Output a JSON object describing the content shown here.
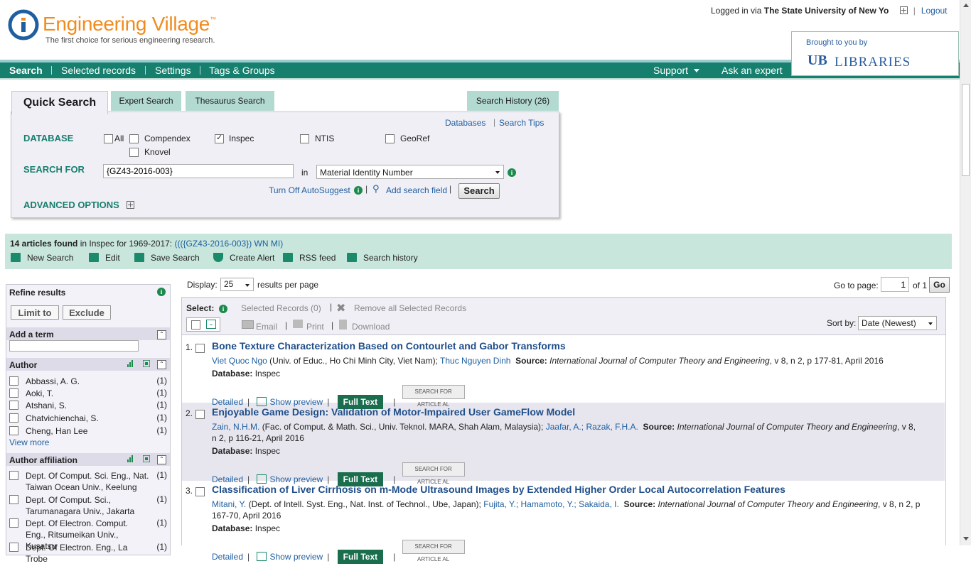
{
  "header": {
    "brand": "Engineering Village",
    "trademark": "™",
    "tagline": "The first choice for serious engineering research.",
    "login_prefix": "Logged in via",
    "login_institution": "The State University of New Yo",
    "logout": "Logout",
    "brought_by": "Brought to you by",
    "library_mark": "UB",
    "library_name": "LIBRARIES"
  },
  "nav": {
    "items": [
      "Search",
      "Selected records",
      "Settings",
      "Tags & Groups"
    ],
    "support": "Support",
    "ask": "Ask an expert"
  },
  "search_tabs": {
    "quick": "Quick Search",
    "expert": "Expert Search",
    "thesaurus": "Thesaurus Search",
    "history": "Search History (26)"
  },
  "search_panel": {
    "databases_link": "Databases",
    "tips_link": "Search Tips",
    "database_label": "DATABASE",
    "databases": [
      {
        "name": "All",
        "checked": false
      },
      {
        "name": "Compendex",
        "checked": false
      },
      {
        "name": "Inspec",
        "checked": true
      },
      {
        "name": "NTIS",
        "checked": false
      },
      {
        "name": "GeoRef",
        "checked": false
      },
      {
        "name": "Knovel",
        "checked": false
      }
    ],
    "search_for_label": "SEARCH FOR",
    "search_value": "{GZ43-2016-003}",
    "in_label": "in",
    "field_value": "Material Identity Number",
    "autosuggest": "Turn Off AutoSuggest",
    "add_field": "Add search field",
    "search_button": "Search",
    "advanced": "ADVANCED OPTIONS"
  },
  "results_bar": {
    "count": "14 articles found",
    "in_text": "in Inspec for 1969-2017:",
    "query": "((({GZ43-2016-003}) WN MI)",
    "tools": [
      "New Search",
      "Edit",
      "Save Search",
      "Create Alert",
      "RSS feed",
      "Search history"
    ]
  },
  "refine": {
    "title": "Refine results",
    "limit": "Limit to",
    "exclude": "Exclude",
    "add_term": "Add a term",
    "author_head": "Author",
    "authors": [
      {
        "name": "Abbassi, A. G.",
        "count": "(1)"
      },
      {
        "name": "Aoki, T.",
        "count": "(1)"
      },
      {
        "name": "Atshani, S.",
        "count": "(1)"
      },
      {
        "name": "Chatvichienchai, S.",
        "count": "(1)"
      },
      {
        "name": "Cheng, Han Lee",
        "count": "(1)"
      }
    ],
    "view_more": "View more",
    "affiliation_head": "Author affiliation",
    "affiliations": [
      {
        "name": "Dept. Of Comput. Sci. Eng., Nat. Taiwan Ocean Univ., Keelung",
        "count": "(1)"
      },
      {
        "name": "Dept. Of Comput. Sci., Tarumanagara Univ., Jakarta",
        "count": "(1)"
      },
      {
        "name": "Dept. Of Electron. Comput. Eng., Ritsumeikan Univ., Kusatsu",
        "count": "(1)"
      },
      {
        "name": "Dept. Of Electron. Eng., La Trobe",
        "count": "(1)"
      }
    ]
  },
  "results_head": {
    "display_label": "Display:",
    "display_value": "25",
    "per_page": "results per page",
    "goto_label": "Go to page:",
    "goto_value": "1",
    "of_text": "of 1",
    "go": "Go"
  },
  "toolbar": {
    "select_label": "Select:",
    "selected": "Selected Records (0)",
    "remove": "Remove all Selected Records",
    "email": "Email",
    "print": "Print",
    "download": "Download",
    "sort_label": "Sort by:",
    "sort_value": "Date (Newest)"
  },
  "results": [
    {
      "num": "1.",
      "title": "Bone Texture Characterization Based on Contourlet and Gabor Transforms",
      "author1": "Viet Quoc Ngo",
      "aff1": "(Univ. of Educ., Ho Chi Minh City, Viet Nam);",
      "author2": "Thuc Nguyen Dinh",
      "author3": "",
      "source_label": "Source:",
      "source": "International Journal of Computer Theory and Engineering",
      "source_rest": ", v 8, n 2, p 177-81, April 2016",
      "db_label": "Database:",
      "db": "Inspec"
    },
    {
      "num": "2.",
      "title": "Enjoyable Game Design: Validation of Motor-Impaired User GameFlow Model",
      "author1": "Zain, N.H.M.",
      "aff1": "(Fac. of Comput. & Math. Sci., Univ. Teknol. MARA, Shah Alam, Malaysia);",
      "author2": "Jaafar, A.;",
      "author3": "Razak, F.H.A.",
      "source_label": "Source:",
      "source": "International Journal of Computer Theory and Engineering",
      "source_rest": ", v 8, n 2, p 116-21, April 2016",
      "db_label": "Database:",
      "db": "Inspec"
    },
    {
      "num": "3.",
      "title": "Classification of Liver Cirrhosis on m-Mode Ultrasound Images by Extended Higher Order Local Autocorrelation Features",
      "author1": "Mitani, Y.",
      "aff1": "(Dept. of Intell. Syst. Eng., Nat. Inst. of Technol., Ube, Japan);",
      "author2": "Fujita, Y.; Hamamoto, Y.;",
      "author3": "Sakaida, I.",
      "source_label": "Source:",
      "source": "International Journal of Computer Theory and Engineering",
      "source_rest": ", v 8, n 2, p 167-70, April 2016",
      "db_label": "Database:",
      "db": "Inspec"
    }
  ],
  "result_actions": {
    "detailed": "Detailed",
    "preview": "Show preview",
    "fulltext": "Full Text",
    "article_al": "SEARCH FOR ARTICLE AL"
  },
  "colors": {
    "brand_orange": "#f08c1e",
    "nav_green": "#177f6e",
    "link_blue": "#1f5fa0"
  }
}
